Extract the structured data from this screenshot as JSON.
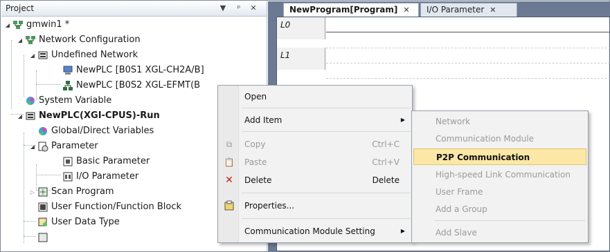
{
  "project_panel": {
    "title": "Project",
    "header_buttons": [
      "▼",
      "ᵖ",
      "✕"
    ],
    "tree": [
      {
        "label": "gmwin1 *",
        "icon": "project-icon",
        "bold": false
      },
      {
        "label": "Network Configuration",
        "icon": "network-config-icon",
        "bold": false
      },
      {
        "label": "Undefined Network",
        "icon": "network-icon",
        "bold": false
      },
      {
        "label": "NewPLC [B0S1 XGL-CH2A/B]",
        "icon": "plc-module-icon",
        "bold": false
      },
      {
        "label": "NewPLC [B0S2 XGL-EFMT(B",
        "icon": "plc-network-icon",
        "bold": false
      },
      {
        "label": "System Variable",
        "icon": "system-variable-icon",
        "bold": false
      },
      {
        "label": "NewPLC(XGI-CPUS)-Run",
        "icon": "plc-cpu-icon",
        "bold": true
      },
      {
        "label": "Global/Direct Variables",
        "icon": "global-variables-icon",
        "bold": false
      },
      {
        "label": "Parameter",
        "icon": "parameter-icon",
        "bold": false
      },
      {
        "label": "Basic Parameter",
        "icon": "basic-parameter-icon",
        "bold": false
      },
      {
        "label": "I/O Parameter",
        "icon": "io-parameter-icon",
        "bold": false
      },
      {
        "label": "Scan Program",
        "icon": "scan-program-icon",
        "bold": false
      },
      {
        "label": "User Function/Function Block",
        "icon": "function-block-icon",
        "bold": false
      },
      {
        "label": "User Data Type",
        "icon": "data-type-icon",
        "bold": false
      }
    ]
  },
  "editor": {
    "tabs": [
      {
        "label": "NewProgram[Program]",
        "close": "✕",
        "active": true
      },
      {
        "label": "I/O Parameter",
        "close": "✕",
        "active": false
      }
    ],
    "rungs": [
      "L0",
      "L1"
    ]
  },
  "context_menu": {
    "items": [
      {
        "label": "Open",
        "shortcut": "",
        "icon": "",
        "disabled": false
      },
      {
        "label": "Add Item",
        "shortcut": "",
        "icon": "",
        "disabled": false,
        "submenu": true
      },
      {
        "label": "Copy",
        "shortcut": "Ctrl+C",
        "icon": "copy-icon",
        "disabled": true
      },
      {
        "label": "Paste",
        "shortcut": "Ctrl+V",
        "icon": "paste-icon",
        "disabled": true
      },
      {
        "label": "Delete",
        "shortcut": "Delete",
        "icon": "delete-icon",
        "disabled": false
      },
      {
        "label": "Properties...",
        "shortcut": "",
        "icon": "properties-icon",
        "disabled": false
      },
      {
        "label": "Communication Module Setting",
        "shortcut": "",
        "icon": "",
        "disabled": false,
        "submenu": true
      }
    ]
  },
  "submenu": {
    "items": [
      {
        "label": "Network",
        "disabled": true
      },
      {
        "label": "Communication Module",
        "disabled": true
      },
      {
        "label": "P2P Communication",
        "disabled": false,
        "highlighted": true
      },
      {
        "label": "High-speed Link Communication",
        "disabled": true
      },
      {
        "label": "User Frame",
        "disabled": true
      },
      {
        "label": "Add a Group",
        "disabled": true
      },
      {
        "label": "Add Slave",
        "disabled": true
      }
    ]
  },
  "colors": {
    "highlight": "#fbe8a6",
    "editor_bg": "#6b7a92",
    "disabled_text": "#9a9a9a"
  }
}
